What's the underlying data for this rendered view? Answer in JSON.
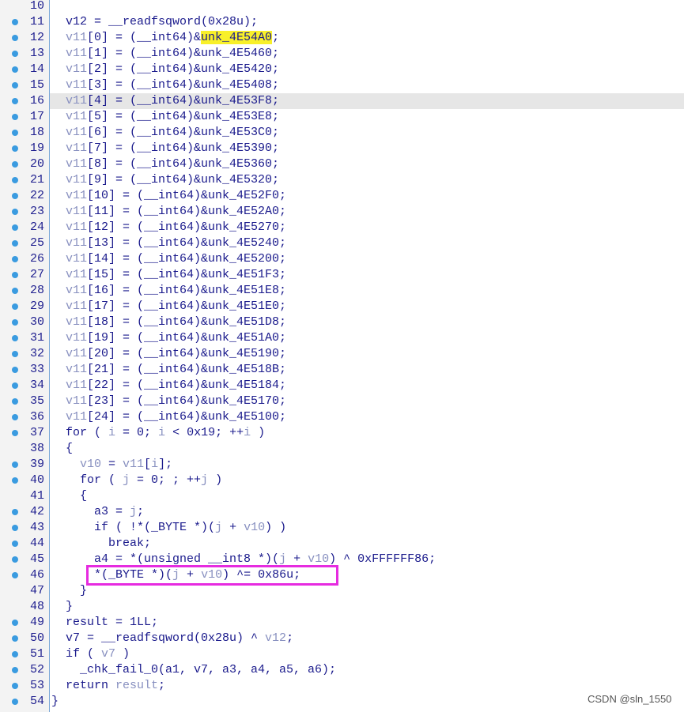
{
  "lines": [
    {
      "n": "10",
      "bp": false,
      "t": []
    },
    {
      "n": "11",
      "bp": true,
      "t": [
        [
          "",
          "  v12 = __readfsqword(0x28u);"
        ]
      ]
    },
    {
      "n": "12",
      "bp": true,
      "t": [
        [
          "v",
          "  v11"
        ],
        [
          "",
          "[0] = (__int64)&"
        ],
        [
          "hl",
          "unk_4E54A0"
        ],
        [
          "",
          ";"
        ]
      ]
    },
    {
      "n": "13",
      "bp": true,
      "t": [
        [
          "v",
          "  v11"
        ],
        [
          "",
          "[1] = (__int64)&unk_4E5460;"
        ]
      ]
    },
    {
      "n": "14",
      "bp": true,
      "t": [
        [
          "v",
          "  v11"
        ],
        [
          "",
          "[2] = (__int64)&unk_4E5420;"
        ]
      ]
    },
    {
      "n": "15",
      "bp": true,
      "t": [
        [
          "v",
          "  v11"
        ],
        [
          "",
          "[3] = (__int64)&unk_4E5408;"
        ]
      ]
    },
    {
      "n": "16",
      "bp": true,
      "t": [
        [
          "v",
          "  v11"
        ],
        [
          "",
          "[4] = (__int64)&unk_4E53F8;"
        ]
      ]
    },
    {
      "n": "17",
      "bp": true,
      "t": [
        [
          "v",
          "  v11"
        ],
        [
          "",
          "[5] = (__int64)&unk_4E53E8;"
        ]
      ]
    },
    {
      "n": "18",
      "bp": true,
      "t": [
        [
          "v",
          "  v11"
        ],
        [
          "",
          "[6] = (__int64)&unk_4E53C0;"
        ]
      ]
    },
    {
      "n": "19",
      "bp": true,
      "t": [
        [
          "v",
          "  v11"
        ],
        [
          "",
          "[7] = (__int64)&unk_4E5390;"
        ]
      ]
    },
    {
      "n": "20",
      "bp": true,
      "t": [
        [
          "v",
          "  v11"
        ],
        [
          "",
          "[8] = (__int64)&unk_4E5360;"
        ]
      ]
    },
    {
      "n": "21",
      "bp": true,
      "t": [
        [
          "v",
          "  v11"
        ],
        [
          "",
          "[9] = (__int64)&unk_4E5320;"
        ]
      ]
    },
    {
      "n": "22",
      "bp": true,
      "t": [
        [
          "v",
          "  v11"
        ],
        [
          "",
          "[10] = (__int64)&unk_4E52F0;"
        ]
      ]
    },
    {
      "n": "23",
      "bp": true,
      "t": [
        [
          "v",
          "  v11"
        ],
        [
          "",
          "[11] = (__int64)&unk_4E52A0;"
        ]
      ]
    },
    {
      "n": "24",
      "bp": true,
      "t": [
        [
          "v",
          "  v11"
        ],
        [
          "",
          "[12] = (__int64)&unk_4E5270;"
        ]
      ]
    },
    {
      "n": "25",
      "bp": true,
      "t": [
        [
          "v",
          "  v11"
        ],
        [
          "",
          "[13] = (__int64)&unk_4E5240;"
        ]
      ]
    },
    {
      "n": "26",
      "bp": true,
      "t": [
        [
          "v",
          "  v11"
        ],
        [
          "",
          "[14] = (__int64)&unk_4E5200;"
        ]
      ]
    },
    {
      "n": "27",
      "bp": true,
      "t": [
        [
          "v",
          "  v11"
        ],
        [
          "",
          "[15] = (__int64)&unk_4E51F3;"
        ]
      ]
    },
    {
      "n": "28",
      "bp": true,
      "t": [
        [
          "v",
          "  v11"
        ],
        [
          "",
          "[16] = (__int64)&unk_4E51E8;"
        ]
      ]
    },
    {
      "n": "29",
      "bp": true,
      "t": [
        [
          "v",
          "  v11"
        ],
        [
          "",
          "[17] = (__int64)&unk_4E51E0;"
        ]
      ]
    },
    {
      "n": "30",
      "bp": true,
      "t": [
        [
          "v",
          "  v11"
        ],
        [
          "",
          "[18] = (__int64)&unk_4E51D8;"
        ]
      ]
    },
    {
      "n": "31",
      "bp": true,
      "t": [
        [
          "v",
          "  v11"
        ],
        [
          "",
          "[19] = (__int64)&unk_4E51A0;"
        ]
      ]
    },
    {
      "n": "32",
      "bp": true,
      "t": [
        [
          "v",
          "  v11"
        ],
        [
          "",
          "[20] = (__int64)&unk_4E5190;"
        ]
      ]
    },
    {
      "n": "33",
      "bp": true,
      "t": [
        [
          "v",
          "  v11"
        ],
        [
          "",
          "[21] = (__int64)&unk_4E518B;"
        ]
      ]
    },
    {
      "n": "34",
      "bp": true,
      "t": [
        [
          "v",
          "  v11"
        ],
        [
          "",
          "[22] = (__int64)&unk_4E5184;"
        ]
      ]
    },
    {
      "n": "35",
      "bp": true,
      "t": [
        [
          "v",
          "  v11"
        ],
        [
          "",
          "[23] = (__int64)&unk_4E5170;"
        ]
      ]
    },
    {
      "n": "36",
      "bp": true,
      "t": [
        [
          "v",
          "  v11"
        ],
        [
          "",
          "[24] = (__int64)&unk_4E5100;"
        ]
      ]
    },
    {
      "n": "37",
      "bp": true,
      "t": [
        [
          "",
          "  for ( "
        ],
        [
          "v",
          "i"
        ],
        [
          "",
          " = 0; "
        ],
        [
          "v",
          "i"
        ],
        [
          "",
          " < 0x19; ++"
        ],
        [
          "v",
          "i"
        ],
        [
          "",
          " )"
        ]
      ]
    },
    {
      "n": "38",
      "bp": false,
      "t": [
        [
          "",
          "  {"
        ]
      ]
    },
    {
      "n": "39",
      "bp": true,
      "t": [
        [
          "v",
          "    v10"
        ],
        [
          "",
          " = "
        ],
        [
          "v",
          "v11"
        ],
        [
          "",
          "["
        ],
        [
          "v",
          "i"
        ],
        [
          "",
          "];"
        ]
      ]
    },
    {
      "n": "40",
      "bp": true,
      "t": [
        [
          "",
          "    for ( "
        ],
        [
          "v",
          "j"
        ],
        [
          "",
          " = 0; ; ++"
        ],
        [
          "v",
          "j"
        ],
        [
          "",
          " )"
        ]
      ]
    },
    {
      "n": "41",
      "bp": false,
      "t": [
        [
          "",
          "    {"
        ]
      ]
    },
    {
      "n": "42",
      "bp": true,
      "t": [
        [
          "",
          "      a3 = "
        ],
        [
          "v",
          "j"
        ],
        [
          "",
          ";"
        ]
      ]
    },
    {
      "n": "43",
      "bp": true,
      "t": [
        [
          "",
          "      if ( !*(_BYTE *)("
        ],
        [
          "v",
          "j"
        ],
        [
          "",
          " + "
        ],
        [
          "v",
          "v10"
        ],
        [
          "",
          ") )"
        ]
      ]
    },
    {
      "n": "44",
      "bp": true,
      "t": [
        [
          "",
          "        break;"
        ]
      ]
    },
    {
      "n": "45",
      "bp": true,
      "t": [
        [
          "",
          "      a4 = *(unsigned __int8 *)("
        ],
        [
          "v",
          "j"
        ],
        [
          "",
          " + "
        ],
        [
          "v",
          "v10"
        ],
        [
          "",
          ") ^ 0xFFFFFF86;"
        ]
      ]
    },
    {
      "n": "46",
      "bp": true,
      "t": [
        [
          "",
          "      *(_BYTE *)("
        ],
        [
          "v",
          "j"
        ],
        [
          "",
          " + "
        ],
        [
          "v",
          "v10"
        ],
        [
          "",
          ") ^= 0x86u;"
        ]
      ]
    },
    {
      "n": "47",
      "bp": false,
      "t": [
        [
          "",
          "    }"
        ]
      ]
    },
    {
      "n": "48",
      "bp": false,
      "t": [
        [
          "",
          "  }"
        ]
      ]
    },
    {
      "n": "49",
      "bp": true,
      "t": [
        [
          "",
          "  result = 1LL;"
        ]
      ]
    },
    {
      "n": "50",
      "bp": true,
      "t": [
        [
          "",
          "  v7 = __readfsqword(0x28u) ^ "
        ],
        [
          "v",
          "v12"
        ],
        [
          "",
          ";"
        ]
      ]
    },
    {
      "n": "51",
      "bp": true,
      "t": [
        [
          "",
          "  if ( "
        ],
        [
          "v",
          "v7"
        ],
        [
          "",
          " )"
        ]
      ]
    },
    {
      "n": "52",
      "bp": true,
      "t": [
        [
          "",
          "    _chk_fail_0(a1, v7, a3, a4, a5, a6);"
        ]
      ]
    },
    {
      "n": "53",
      "bp": true,
      "t": [
        [
          "",
          "  return "
        ],
        [
          "v",
          "result"
        ],
        [
          "",
          ";"
        ]
      ]
    },
    {
      "n": "54",
      "bp": true,
      "t": [
        [
          "",
          "}"
        ]
      ]
    }
  ],
  "selected_line": "16",
  "highlight_box_line": "46",
  "watermark": "CSDN @sln_1550",
  "colors": {
    "breakpoint": "#3a9be0",
    "variable": "#8890c0",
    "code": "#1a1a8c",
    "highlight": "#f8f02a",
    "box": "#e62be0"
  }
}
